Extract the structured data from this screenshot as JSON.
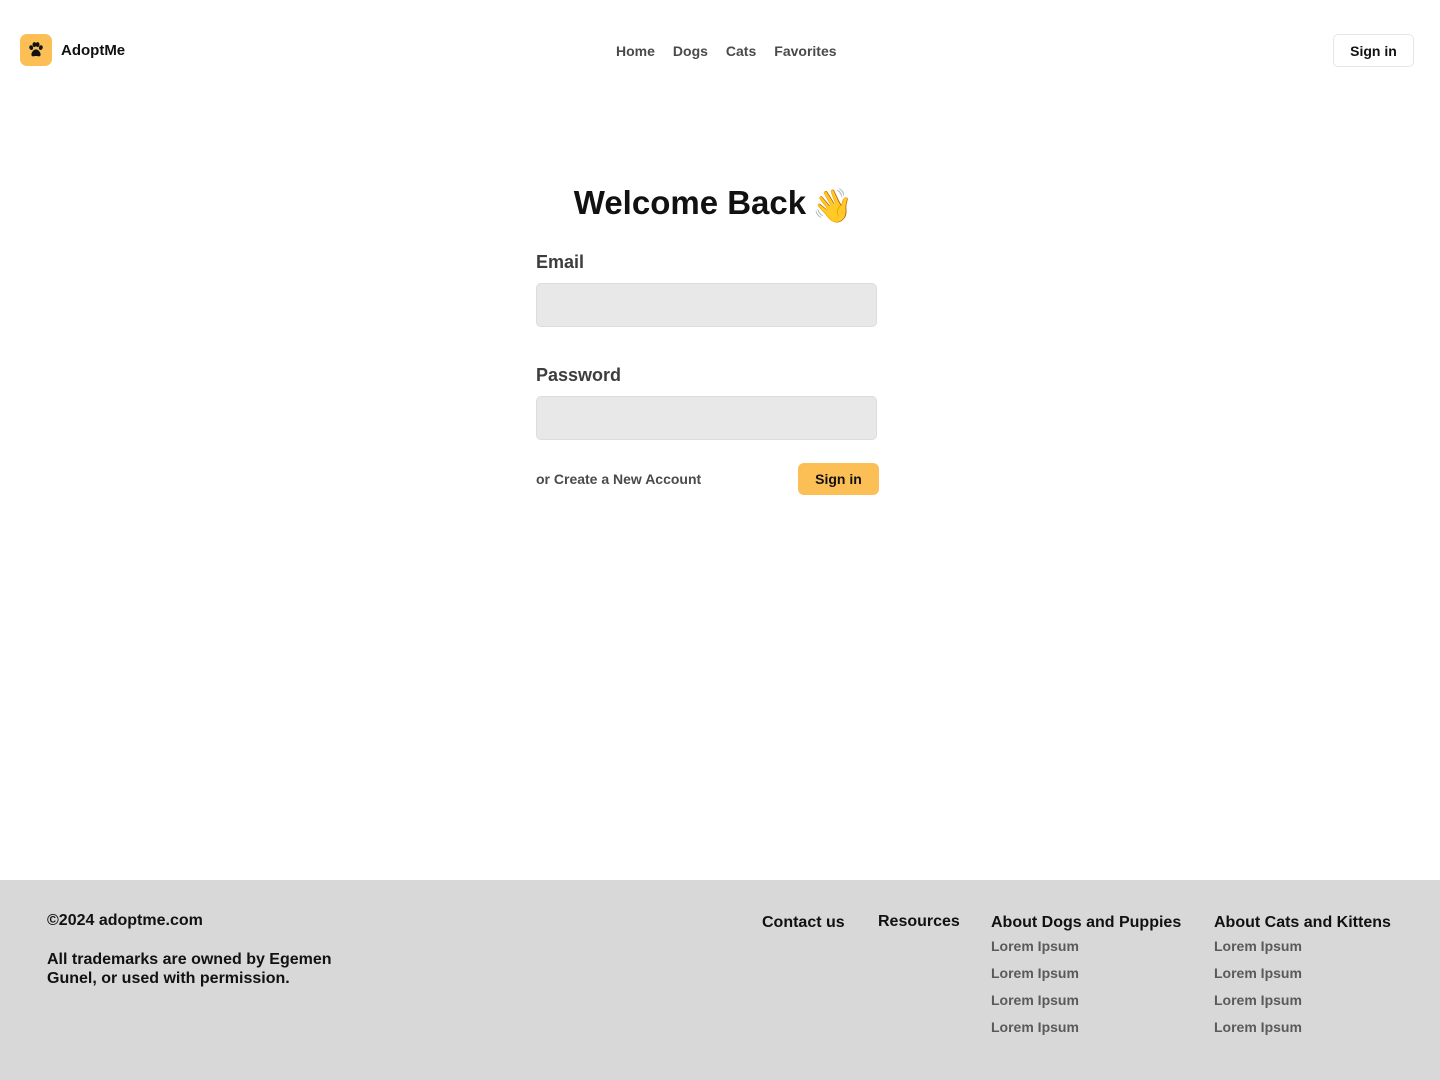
{
  "header": {
    "brand_name": "AdoptMe",
    "nav": [
      "Home",
      "Dogs",
      "Cats",
      "Favorites"
    ],
    "signin_label": "Sign in"
  },
  "icons": {
    "brand_logo": "paw-icon",
    "title_emoji": "waving-hand-icon"
  },
  "colors": {
    "accent": "#fbbf56",
    "input_bg": "#e8e8e8",
    "footer_bg": "#d8d8d8"
  },
  "login": {
    "title": "Welcome Back",
    "title_emoji": "👋",
    "email_label": "Email",
    "email_value": "",
    "password_label": "Password",
    "password_value": "",
    "create_account_label": "or Create a New Account",
    "submit_label": "Sign in"
  },
  "footer": {
    "copyright": "©2024 adoptme.com",
    "trademark": "All trademarks are owned by Egemen Gunel, or used with permission.",
    "columns": [
      {
        "heading": "Contact us",
        "links": []
      },
      {
        "heading": "Resources",
        "links": []
      },
      {
        "heading": "About Dogs and Puppies",
        "links": [
          "Lorem Ipsum",
          "Lorem Ipsum",
          "Lorem Ipsum",
          "Lorem Ipsum"
        ]
      },
      {
        "heading": "About Cats and Kittens",
        "links": [
          "Lorem Ipsum",
          "Lorem Ipsum",
          "Lorem Ipsum",
          "Lorem Ipsum"
        ]
      }
    ]
  }
}
